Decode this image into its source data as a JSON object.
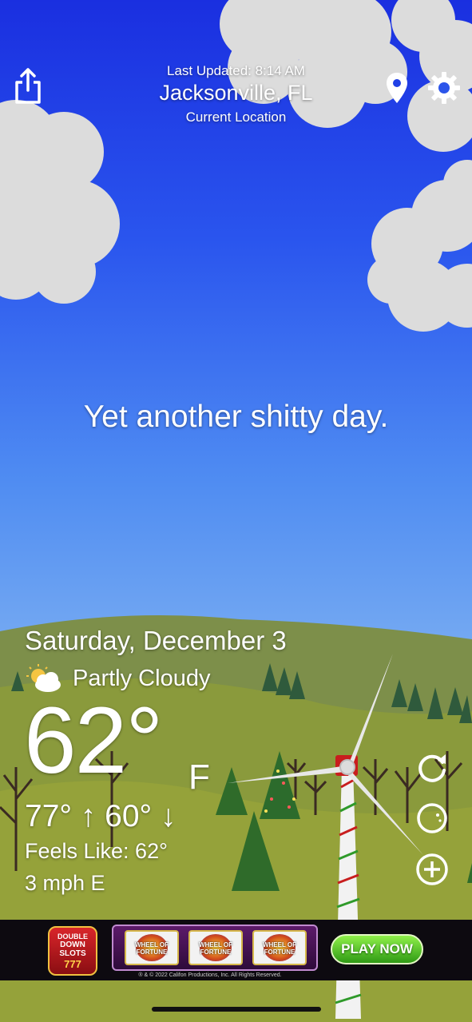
{
  "header": {
    "last_updated": "Last Updated: 8:14 AM",
    "city": "Jacksonville, FL",
    "location_label": "Current Location"
  },
  "tagline": "Yet another shitty day.",
  "weather": {
    "date": "Saturday, December 3",
    "condition": "Partly Cloudy",
    "temperature": "62°",
    "unit": "F",
    "hi_lo": "77° ↑  60° ↓",
    "feels_like": "Feels Like: 62°",
    "wind": "3 mph E"
  },
  "icons": {
    "share": "share-icon",
    "location": "location-pin-icon",
    "settings": "gear-icon",
    "refresh": "refresh-icon",
    "moon": "moon-icon",
    "add": "add-circle-icon",
    "condition": "partly-cloudy-icon"
  },
  "ad": {
    "logo_line1": "DOUBLE",
    "logo_line2": "DOWN SLOTS",
    "logo_line3": "777",
    "reel_label": "WHEEL OF FORTUNE",
    "cta": "PLAY NOW",
    "copyright": "® & © 2022 Califon Productions, Inc. All Rights Reserved."
  },
  "colors": {
    "sky_top": "#1a2fe0",
    "sky_bottom": "#73a8f2",
    "grass": "#8a9a3c",
    "cta": "#4fc42a"
  }
}
